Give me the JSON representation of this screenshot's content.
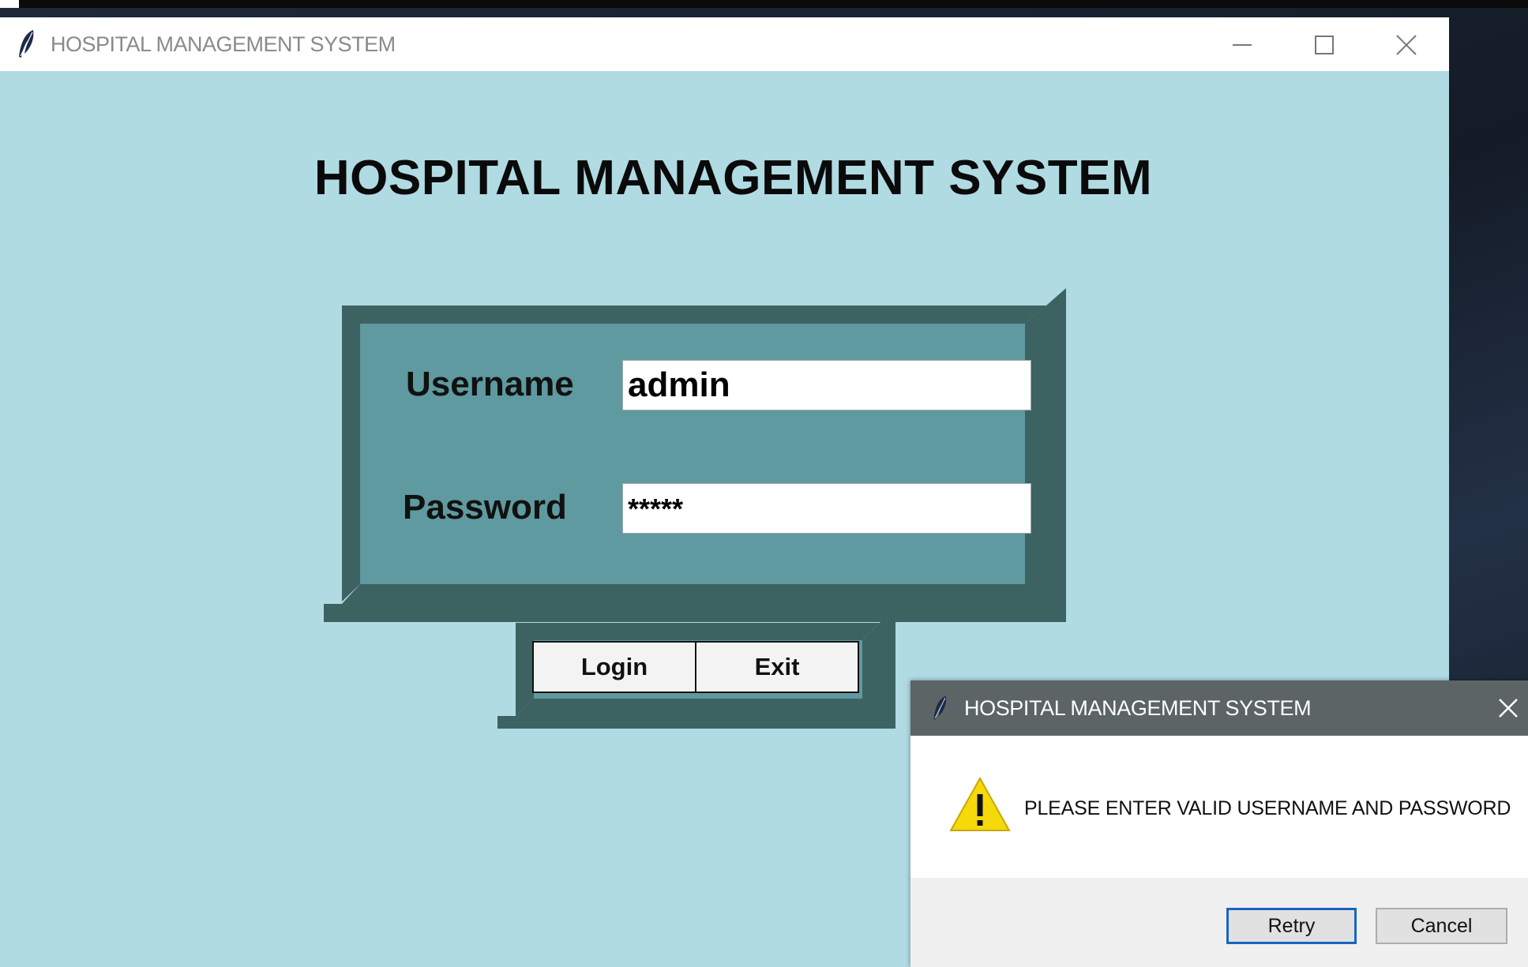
{
  "window": {
    "title": "HOSPITAL MANAGEMENT SYSTEM",
    "controls": {
      "minimize": "minimize-icon",
      "maximize": "maximize-icon",
      "close": "close-icon"
    }
  },
  "main": {
    "heading": "HOSPITAL MANAGEMENT SYSTEM",
    "username_label": "Username",
    "username_value": "admin",
    "password_label": "Password",
    "password_value": "*****",
    "login_label": "Login",
    "exit_label": "Exit"
  },
  "dialog": {
    "title": "HOSPITAL MANAGEMENT SYSTEM",
    "icon": "warning-icon",
    "message": "PLEASE ENTER VALID USERNAME AND PASSWORD",
    "retry_label": "Retry",
    "cancel_label": "Cancel"
  },
  "colors": {
    "window_bg": "#b0dbe3",
    "frame_dark": "#3d6262",
    "frame_inner": "#5e9a9f",
    "dialog_title_bg": "#5c6465",
    "retry_border": "#1c64c4"
  }
}
